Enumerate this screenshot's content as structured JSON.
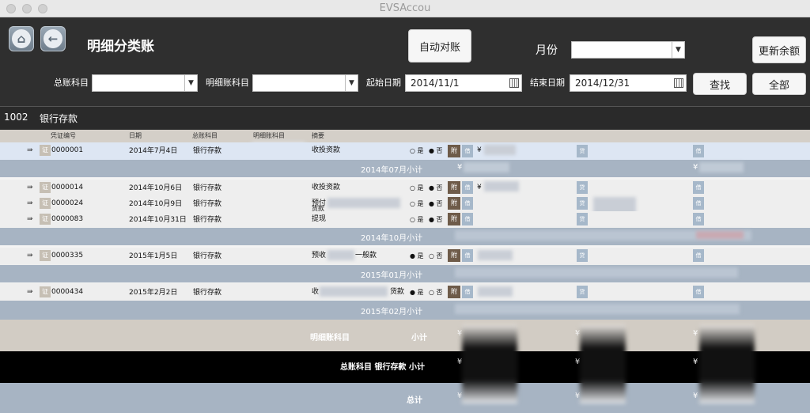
{
  "window": {
    "title": "EVSAccou"
  },
  "header": {
    "page_title": "明细分类账",
    "auto_reconcile": "自动对账",
    "month_label": "月份",
    "month_value": "",
    "update_balance": "更新余额",
    "general_account_label": "总账科目",
    "general_account_value": "",
    "detail_account_label": "明细账科目",
    "detail_account_value": "",
    "start_date_label": "起始日期",
    "start_date_value": "2014/11/1",
    "end_date_label": "结束日期",
    "end_date_value": "2014/12/31",
    "search_button": "查找",
    "all_button": "全部"
  },
  "account": {
    "code": "1002",
    "name": "银行存款"
  },
  "columns": [
    "凭证编号",
    "日期",
    "总账科目",
    "明细账科目",
    "摘要"
  ],
  "labels": {
    "yes": "是",
    "no": "否",
    "attach": "附",
    "debit": "借",
    "credit": "贷",
    "yen": "¥",
    "doc": "证"
  },
  "rows": [
    {
      "voucher": "0000001",
      "date": "2014年7月4日",
      "account": "银行存款",
      "summary": "收投资款",
      "selected": "no"
    },
    {
      "voucher": "0000014",
      "date": "2014年10月6日",
      "account": "银行存款",
      "summary": "收投资款",
      "selected": "no"
    },
    {
      "voucher": "0000024",
      "date": "2014年10月9日",
      "account": "银行存款",
      "summary": "预付",
      "summary2": "货款",
      "selected": "no"
    },
    {
      "voucher": "0000083",
      "date": "2014年10月31日",
      "account": "银行存款",
      "summary": "提现",
      "selected": "no"
    },
    {
      "voucher": "0000335",
      "date": "2015年1月5日",
      "account": "银行存款",
      "summary": "预收",
      "summary2": "一般款",
      "selected": "yes"
    },
    {
      "voucher": "0000434",
      "date": "2015年2月2日",
      "account": "银行存款",
      "summary": "收",
      "summary2": "货款",
      "selected": "yes"
    }
  ],
  "subtotals": [
    "2014年07月小计",
    "2014年10月小计",
    "2015年01月小计",
    "2015年02月小计"
  ],
  "footer": {
    "detail_subtotal_label": "明细账科目",
    "detail_subtotal_suffix": "小计",
    "general_subtotal": "总账科目 银行存款 小计",
    "grand_total": "总计"
  },
  "colors": {
    "header_bg": "#2f2f2f",
    "subtotal_bg": "#a7b4c3",
    "attach_btn": "#6e5b49",
    "debit_btn": "#a6b8ca"
  }
}
